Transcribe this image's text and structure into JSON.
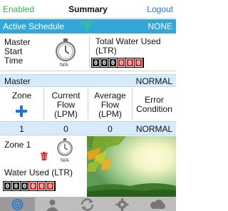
{
  "header": {
    "left_label": "Enabled",
    "title": "Summary",
    "right_label": "Logout"
  },
  "schedule": {
    "label": "Active Schedule",
    "icon": "wifi-icon",
    "value": "NONE"
  },
  "master_summary": {
    "start_label_line1": "Master",
    "start_label_line2": "Start",
    "start_label_line3": "Time",
    "start_value": "N/A",
    "water_label_line1": "Total Water Used",
    "water_label_line2": "(LTR)",
    "water_digits": [
      "0",
      "0",
      "0",
      "0",
      "0",
      "0"
    ],
    "water_red_from": 3
  },
  "master_band": {
    "name": "Master",
    "status": "NORMAL"
  },
  "columns": {
    "zone": "Zone",
    "current_flow_1": "Current",
    "current_flow_2": "Flow",
    "current_flow_3": "(LPM)",
    "average_flow_1": "Average",
    "average_flow_2": "Flow",
    "average_flow_3": "(LPM)",
    "error_1": "Error",
    "error_2": "Condition"
  },
  "zone_rows": [
    {
      "zone": "1",
      "current": "0",
      "average": "0",
      "condition": "NORMAL"
    }
  ],
  "zone_detail": {
    "title": "Zone 1",
    "start_value": "N/A",
    "water_label": "Water Used (LTR)",
    "water_digits": [
      "0",
      "0",
      "0",
      "0",
      "0",
      "0"
    ],
    "water_red_from": 3
  },
  "tabs": [
    "summary-tab",
    "users-tab",
    "sync-tab",
    "settings-tab",
    "weather-tab"
  ],
  "colors": {
    "accent_blue": "#33a8d8",
    "enabled_green": "#2fb84a",
    "link_blue": "#1e78d2",
    "band": "#d7eaf8",
    "red_digit": "#e32020"
  }
}
